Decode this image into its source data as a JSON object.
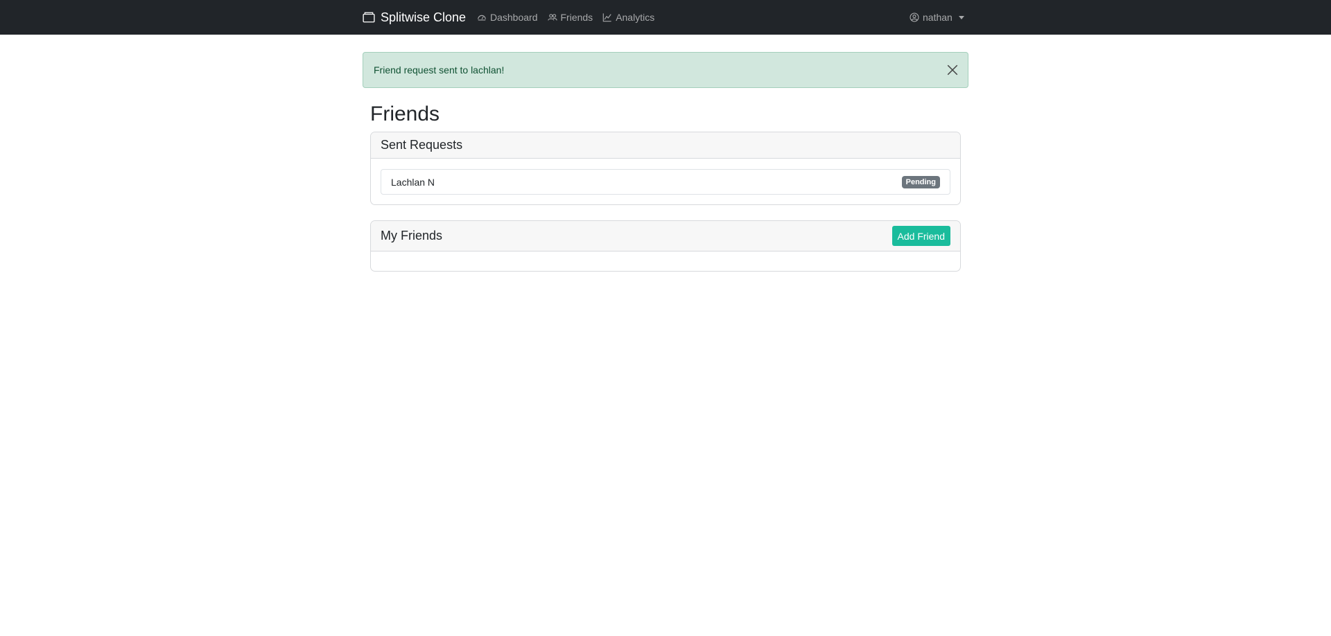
{
  "navbar": {
    "brand": "Splitwise Clone",
    "links": [
      {
        "label": "Dashboard",
        "icon": "speedometer-icon"
      },
      {
        "label": "Friends",
        "icon": "people-icon"
      },
      {
        "label": "Analytics",
        "icon": "graph-icon"
      }
    ],
    "user": {
      "name": "nathan",
      "icon": "person-circle-icon"
    }
  },
  "alert": {
    "message": "Friend request sent to lachlan!"
  },
  "page": {
    "title": "Friends"
  },
  "sent_requests": {
    "title": "Sent Requests",
    "items": [
      {
        "name": "Lachlan N",
        "status": "Pending"
      }
    ]
  },
  "my_friends": {
    "title": "My Friends",
    "add_button": "Add Friend",
    "items": []
  },
  "colors": {
    "navbar": "#212529",
    "alert_bg": "#d1e7dd",
    "add_button": "#1abc9c",
    "badge": "#6c757d"
  }
}
